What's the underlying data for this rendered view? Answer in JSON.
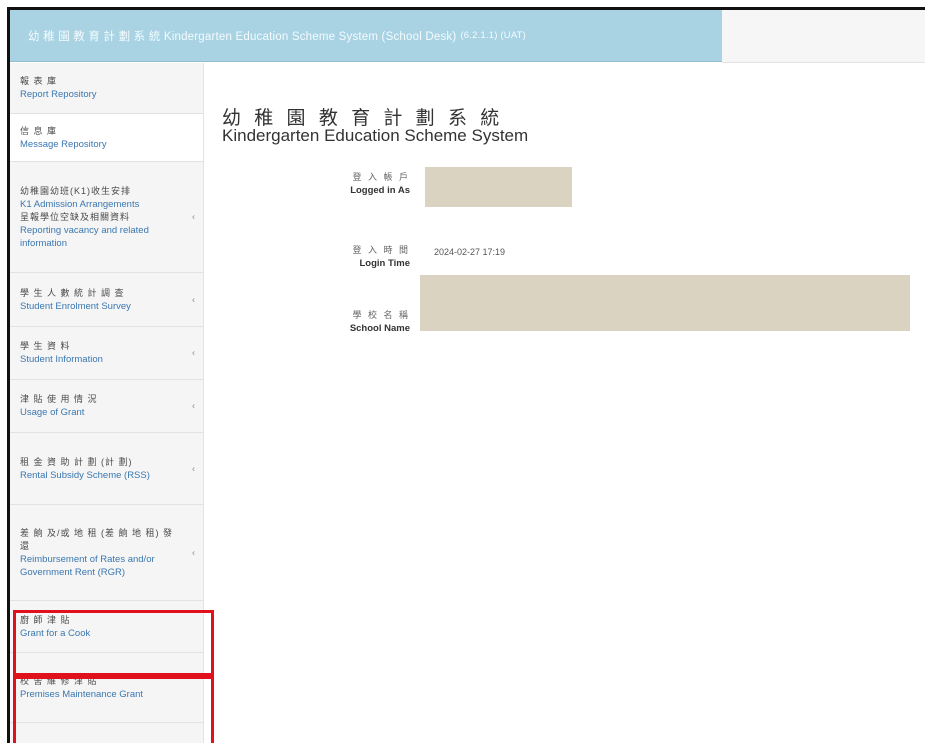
{
  "header": {
    "title": "幼 稚 園 教 育 計 劃 系 統 Kindergarten Education Scheme System (School Desk)",
    "version": "(6.2.1.1) (UAT)"
  },
  "sidebar": {
    "items": [
      {
        "zh": "報 表 庫",
        "en": "Report Repository",
        "caret": false
      },
      {
        "zh": "信 息 庫",
        "en": "Message Repository",
        "caret": false
      },
      {
        "zh": "幼稚園幼班(K1)收生安排",
        "en": "K1 Admission Arrangements",
        "zh2": "呈報學位空缺及相關資料",
        "en2": "Reporting vacancy and related information",
        "caret": true
      },
      {
        "zh": "學 生 人 數 統 計 調 查",
        "en": "Student Enrolment Survey",
        "caret": true
      },
      {
        "zh": "學 生 資 料",
        "en": "Student Information",
        "caret": true
      },
      {
        "zh": "津 貼 使 用 情 況",
        "en": "Usage of Grant",
        "caret": true
      },
      {
        "zh": "租 金 資 助 計 劃 (計 劃)",
        "en": "Rental Subsidy Scheme (RSS)",
        "caret": true
      },
      {
        "zh": "差 餉 及/或 地 租 (差 餉 地 租) 發 還",
        "en": "Reimbursement of Rates and/or Government Rent (RGR)",
        "caret": true
      },
      {
        "zh": "廚 師 津 貼",
        "en": "Grant for a Cook",
        "caret": false
      },
      {
        "zh": "校 舍 維 修 津 貼",
        "en": "Premises Maintenance Grant",
        "caret": false
      }
    ],
    "caret_glyph": "‹"
  },
  "main": {
    "title_zh": "幼 稚 園 教 育 計 劃 系 統",
    "title_en": "Kindergarten Education Scheme System",
    "fields": [
      {
        "zh": "登 入 帳 戶",
        "en": "Logged in As",
        "value": ""
      },
      {
        "zh": "登 入 時 間",
        "en": "Login Time",
        "value": "2024-02-27 17:19"
      },
      {
        "zh": "學 校 名 稱",
        "en": "School Name",
        "value": ""
      }
    ]
  },
  "colors": {
    "header_bg": "#a9d3e3",
    "link": "#3a77b0",
    "highlight_border": "#e0101c",
    "redaction": "#dbd3c1"
  }
}
